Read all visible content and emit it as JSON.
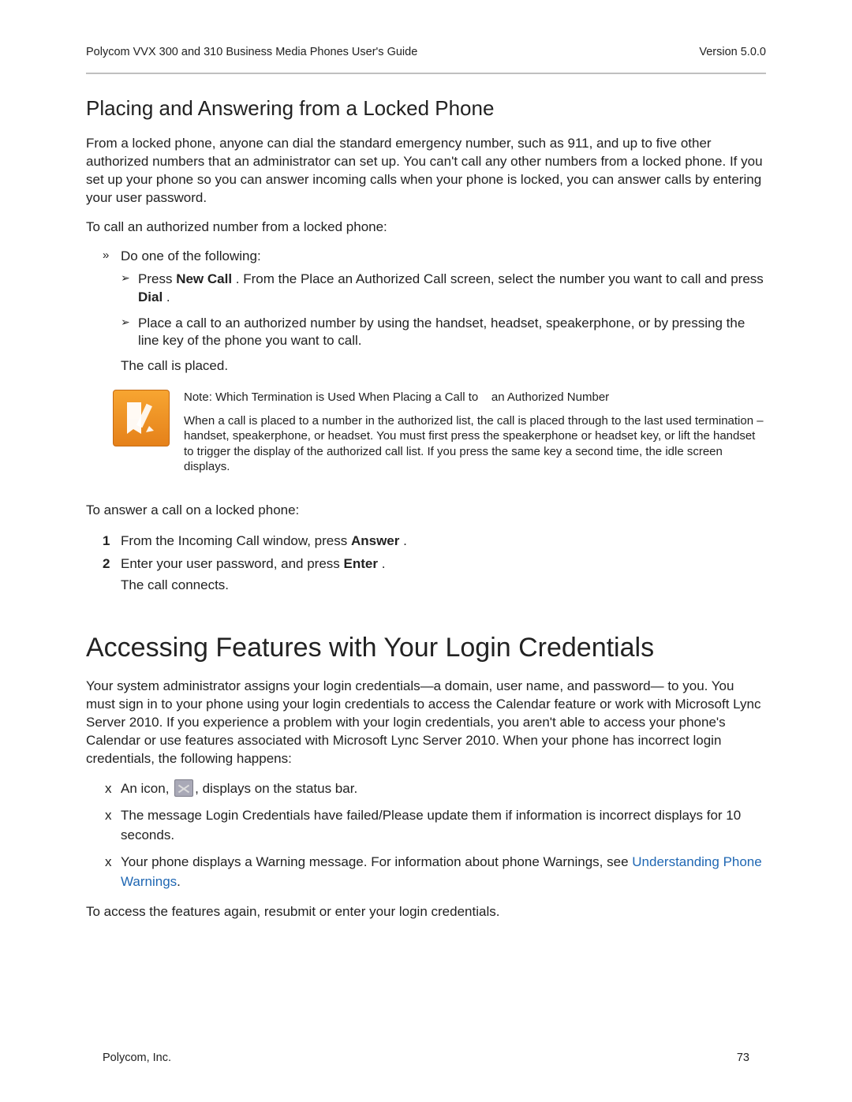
{
  "header": {
    "title": "Polycom VVX 300 and 310 Business Media Phones User's Guide",
    "version": "Version 5.0.0"
  },
  "section1": {
    "heading": "Placing  and Answering from a Locked Phone",
    "p1": "From a locked phone, anyone can dial the standard emergency number, such as 911, and up to five other authorized numbers that an administrator can set up. You can't call any other numbers from a locked phone. If you set up your phone so you can answer incoming calls when your phone is locked, you can answer calls by entering your user password.",
    "intro1": "To call an authorized number from a locked phone:",
    "bullet1": "Do one of the following:",
    "sub1_a": "Press ",
    "sub1_b": "New Call",
    "sub1_c": " . From the Place an Authorized Call screen, select the number you want to call and press ",
    "sub1_d": "Dial",
    "sub1_e": " .",
    "sub2": "Place a call to an authorized number by using the handset, headset, speakerphone, or by pressing the line key of the phone you want to call.",
    "after": "The call is placed.",
    "note_title_a": "Note",
    "note_title_b": ": Which Termination is Used When Placing a Call to",
    "note_title_c": "an Authorized Number",
    "note_body": "When a call is placed to a number in the authorized list, the call is placed through to the last used termination – handset, speakerphone, or headset. You must first press the speakerphone or headset key, or lift the handset to trigger the display of the authorized call list. If you press the same key a second time, the idle screen displays.",
    "intro2": "To answer a call on a locked phone:",
    "n1_a": "From the Incoming Call window, press ",
    "n1_b": "Answer",
    "n1_c": " .",
    "n2_a": "Enter your user password, and press ",
    "n2_b": "Enter",
    "n2_c": " .",
    "n_after": "The call connects."
  },
  "section2": {
    "heading": "Accessing Features with Your Login Credentials",
    "p1": "Your system administrator assigns your login credentials—a domain, user name, and password— to you. You must sign in to your phone using your login credentials to access the Calendar feature or work with Microsoft Lync Server 2010. If you experience a problem with your login credentials, you aren't able to access your phone's Calendar or use features associated with Microsoft Lync Server 2010. When your phone has incorrect login credentials, the following happens:",
    "x1_a": "An icon, ",
    "x1_b": ", displays on the status bar.",
    "x2": "The message Login Credentials have failed/Please update them if information is incorrect displays for 10 seconds.",
    "x3_a": "Your phone displays a Warning message. For information about phone Warnings, see ",
    "x3_link": "Understanding Phone Warnings",
    "x3_b": ".",
    "p2": "To access the features again, resubmit or enter your login credentials."
  },
  "footer": {
    "company": "Polycom, Inc.",
    "page": "73"
  },
  "icons": {
    "note": "note-pencil-icon",
    "status": "credentials-error-icon"
  }
}
